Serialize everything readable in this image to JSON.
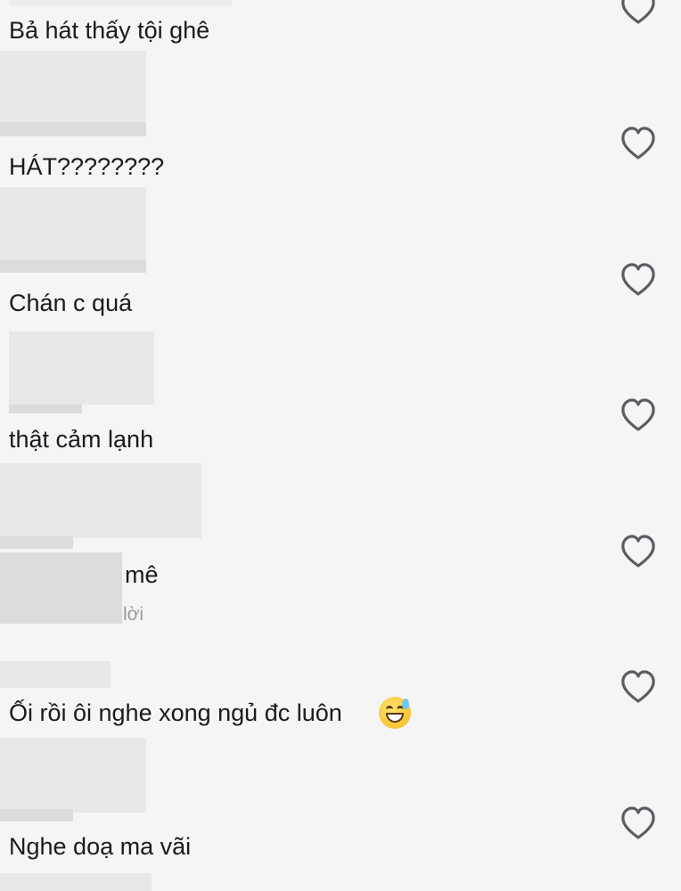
{
  "comments": [
    {
      "text": "Bả hát thấy tội ghê"
    },
    {
      "text": "HÁT????????"
    },
    {
      "text": "Chán c quá"
    },
    {
      "text": "thật cảm lạnh"
    },
    {
      "text": "mê",
      "reply_fragment": "lời"
    },
    {
      "text": "Ối rồi ôi nghe xong ngủ đc luôn",
      "emoji": "grinning-face-with-sweat"
    },
    {
      "text": "Nghe doạ ma vãi"
    }
  ],
  "icons": {
    "like": "heart-outline-icon"
  },
  "colors": {
    "background": "#f5f5f6",
    "text": "#1a1a1f",
    "icon": "#5c5c63"
  }
}
